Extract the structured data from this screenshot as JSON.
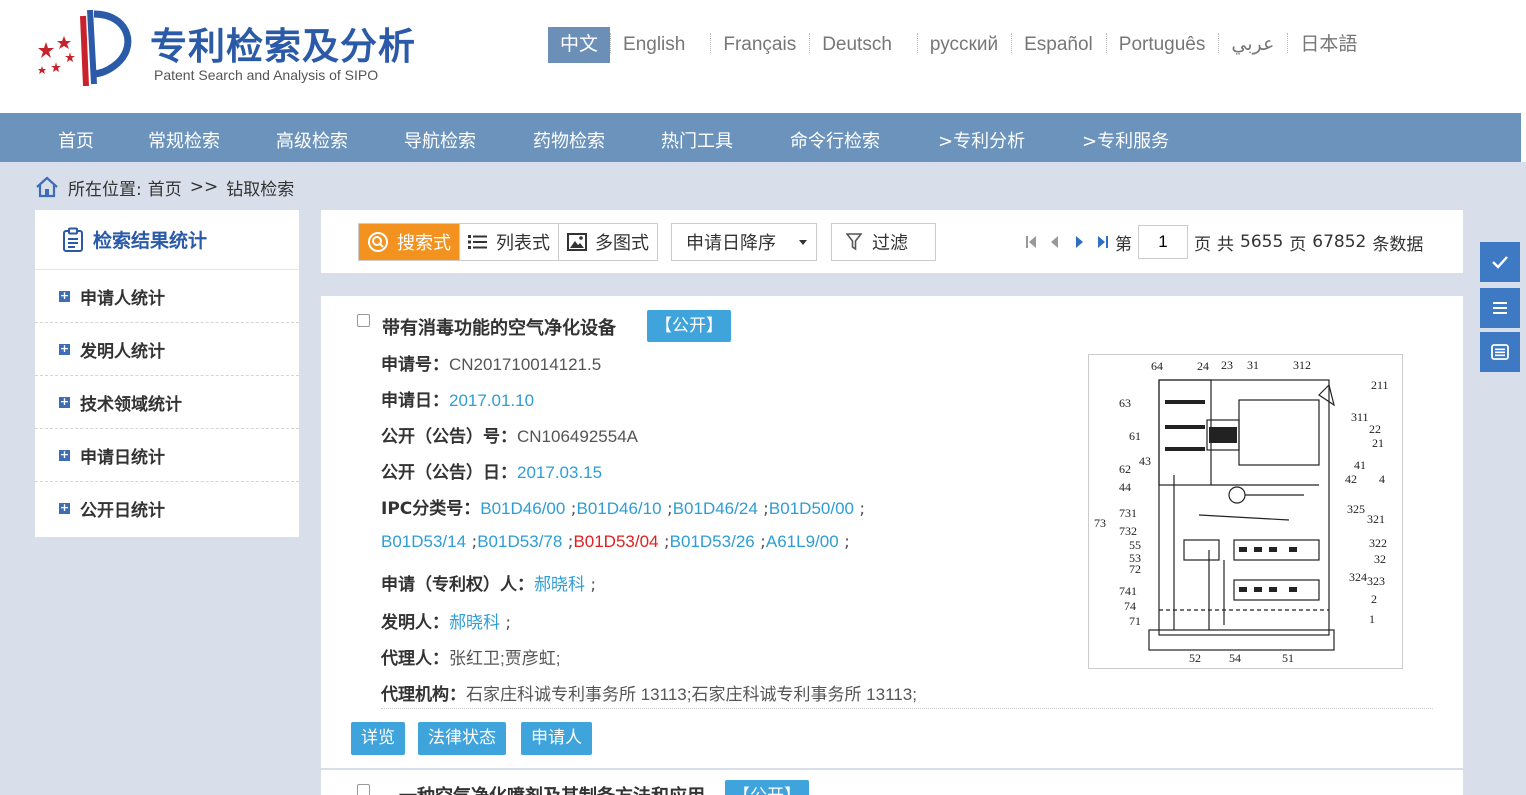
{
  "header": {
    "title": "专利检索及分析",
    "subtitle": "Patent Search and Analysis of SIPO",
    "languages": [
      "中文",
      "English",
      "Français",
      "Deutsch",
      "русский",
      "Español",
      "Português",
      "عربي",
      "日本語"
    ]
  },
  "nav": {
    "items": [
      "首页",
      "常规检索",
      "高级检索",
      "导航检索",
      "药物检索",
      "热门工具",
      "命令行检索",
      ">专利分析",
      ">专利服务"
    ]
  },
  "breadcrumb": {
    "label": "所在位置:",
    "home": "首页",
    "separator": ">>",
    "current": "钻取检索"
  },
  "sidebar": {
    "title": "检索结果统计",
    "items": [
      "申请人统计",
      "发明人统计",
      "技术领域统计",
      "申请日统计",
      "公开日统计"
    ]
  },
  "toolbar": {
    "views": [
      "搜索式",
      "列表式",
      "多图式"
    ],
    "sort": "申请日降序",
    "filter": "过滤",
    "pager": {
      "prefix": "第",
      "page": "1",
      "page_unit": "页",
      "total_prefix": "共",
      "total_pages": "5655",
      "total_pages_unit": "页",
      "total_records": "67852",
      "records_unit": "条数据"
    }
  },
  "result": {
    "title": "带有消毒功能的空气净化设备",
    "status": "【公开】",
    "app_no_label": "申请号：",
    "app_no": "CN201710014121.5",
    "app_date_label": "申请日：",
    "app_date": "2017.01.10",
    "pub_no_label": "公开（公告）号：",
    "pub_no": "CN106492554A",
    "pub_date_label": "公开（公告）日：",
    "pub_date": "2017.03.15",
    "ipc_label": "IPC分类号：",
    "ipc_line1": [
      "B01D46/00",
      "B01D46/10",
      "B01D46/24",
      "B01D50/00"
    ],
    "ipc_line2": [
      "B01D53/14",
      "B01D53/78",
      "B01D53/04",
      "B01D53/26",
      "A61L9/00"
    ],
    "applicant_label": "申请（专利权）人：",
    "applicant": "郝晓科",
    "inventor_label": "发明人：",
    "inventor": "郝晓科",
    "agent_label": "代理人：",
    "agent": "张红卫;贾彦虹;",
    "agency_label": "代理机构：",
    "agency": "石家庄科诚专利事务所 13113;石家庄科诚专利事务所 13113;",
    "actions": [
      "详览",
      "法律状态",
      "申请人"
    ],
    "figure_labels": [
      "64",
      "24",
      "23",
      "31",
      "312",
      "211",
      "63",
      "311",
      "22",
      "21",
      "61",
      "41",
      "4",
      "62",
      "43",
      "42",
      "44",
      "325",
      "731",
      "321",
      "73",
      "732",
      "322",
      "55",
      "53",
      "32",
      "72",
      "324",
      "323",
      "741",
      "2",
      "74",
      "71",
      "1",
      "52",
      "54",
      "51"
    ]
  },
  "result2": {
    "title": "一种空气净化喷剂及其制备方法和应用",
    "status": "【公开】"
  },
  "colors": {
    "nav": "#6b93bc",
    "accent": "#f4921f",
    "link": "#2e9dd6",
    "highlight": "#e02020",
    "brand": "#2a5aa8"
  }
}
